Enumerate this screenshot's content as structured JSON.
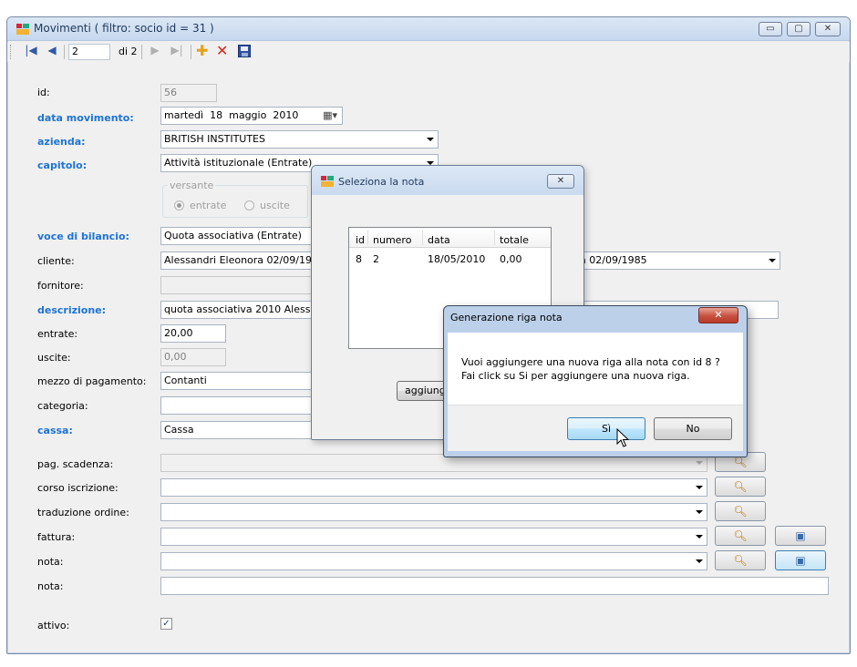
{
  "window": {
    "title": "Movimenti ( filtro: socio id = 31 )",
    "controls": {
      "minimize": "▭",
      "maximize": "▢",
      "close": "✕"
    }
  },
  "toolbar": {
    "record_value": "2",
    "record_of": "di 2",
    "icons": [
      "first-icon",
      "prev-icon",
      "next-icon",
      "last-icon",
      "add-icon",
      "delete-icon",
      "save-icon"
    ]
  },
  "form": {
    "id": {
      "label": "id:",
      "value": "56"
    },
    "data_movimento": {
      "label": "data movimento:",
      "day": "martedì",
      "date": "18",
      "month": "maggio",
      "year": "2010"
    },
    "azienda": {
      "label": "azienda:",
      "value": "BRITISH INSTITUTES"
    },
    "capitolo": {
      "label": "capitolo:",
      "value": "Attività istituzionale (Entrate)"
    },
    "versante": {
      "legend": "versante",
      "option_entrate": "entrate",
      "option_uscite": "uscite"
    },
    "voce_bilancio": {
      "label": "voce di bilancio:",
      "value": "Quota associativa (Entrate)"
    },
    "cliente": {
      "label": "cliente:",
      "value": "Alessandri Eleonora 02/09/1985",
      "value_tail": "a 02/09/1985"
    },
    "fornitore": {
      "label": "fornitore:",
      "value": ""
    },
    "descrizione": {
      "label": "descrizione:",
      "value": "quota associativa 2010 Alessandri"
    },
    "entrate": {
      "label": "entrate:",
      "value": "20,00"
    },
    "uscite": {
      "label": "uscite:",
      "value": "0,00"
    },
    "mezzo_pagamento": {
      "label": "mezzo di pagamento:",
      "value": "Contanti"
    },
    "categoria": {
      "label": "categoria:",
      "value": ""
    },
    "cassa": {
      "label": "cassa:",
      "value": "Cassa"
    },
    "pag_scadenza": {
      "label": "pag. scadenza:"
    },
    "corso_iscrizione": {
      "label": "corso iscrizione:"
    },
    "traduzione_ordine": {
      "label": "traduzione ordine:"
    },
    "fattura": {
      "label": "fattura:"
    },
    "nota_select": {
      "label": "nota:"
    },
    "nota_text": {
      "label": "nota:",
      "value": ""
    },
    "attivo": {
      "label": "attivo:",
      "check": "✓"
    }
  },
  "dialog_nota": {
    "title": "Seleziona la nota",
    "columns": [
      "id",
      "numero",
      "data",
      "totale"
    ],
    "rows": [
      [
        "8",
        "2",
        "18/05/2010",
        "0,00"
      ]
    ],
    "button": "aggiungi"
  },
  "msgbox": {
    "title": "Generazione riga nota",
    "line1": "Vuoi aggiungere una nuova riga alla nota con id 8 ?",
    "line2": "Fai click su Si per aggiungere una nuova riga.",
    "yes": "Sì",
    "no": "No",
    "close": "✕"
  },
  "colors": {
    "required_label": "#1e73d6",
    "title_text": "#1e395b",
    "close_red": "#c7513f"
  }
}
